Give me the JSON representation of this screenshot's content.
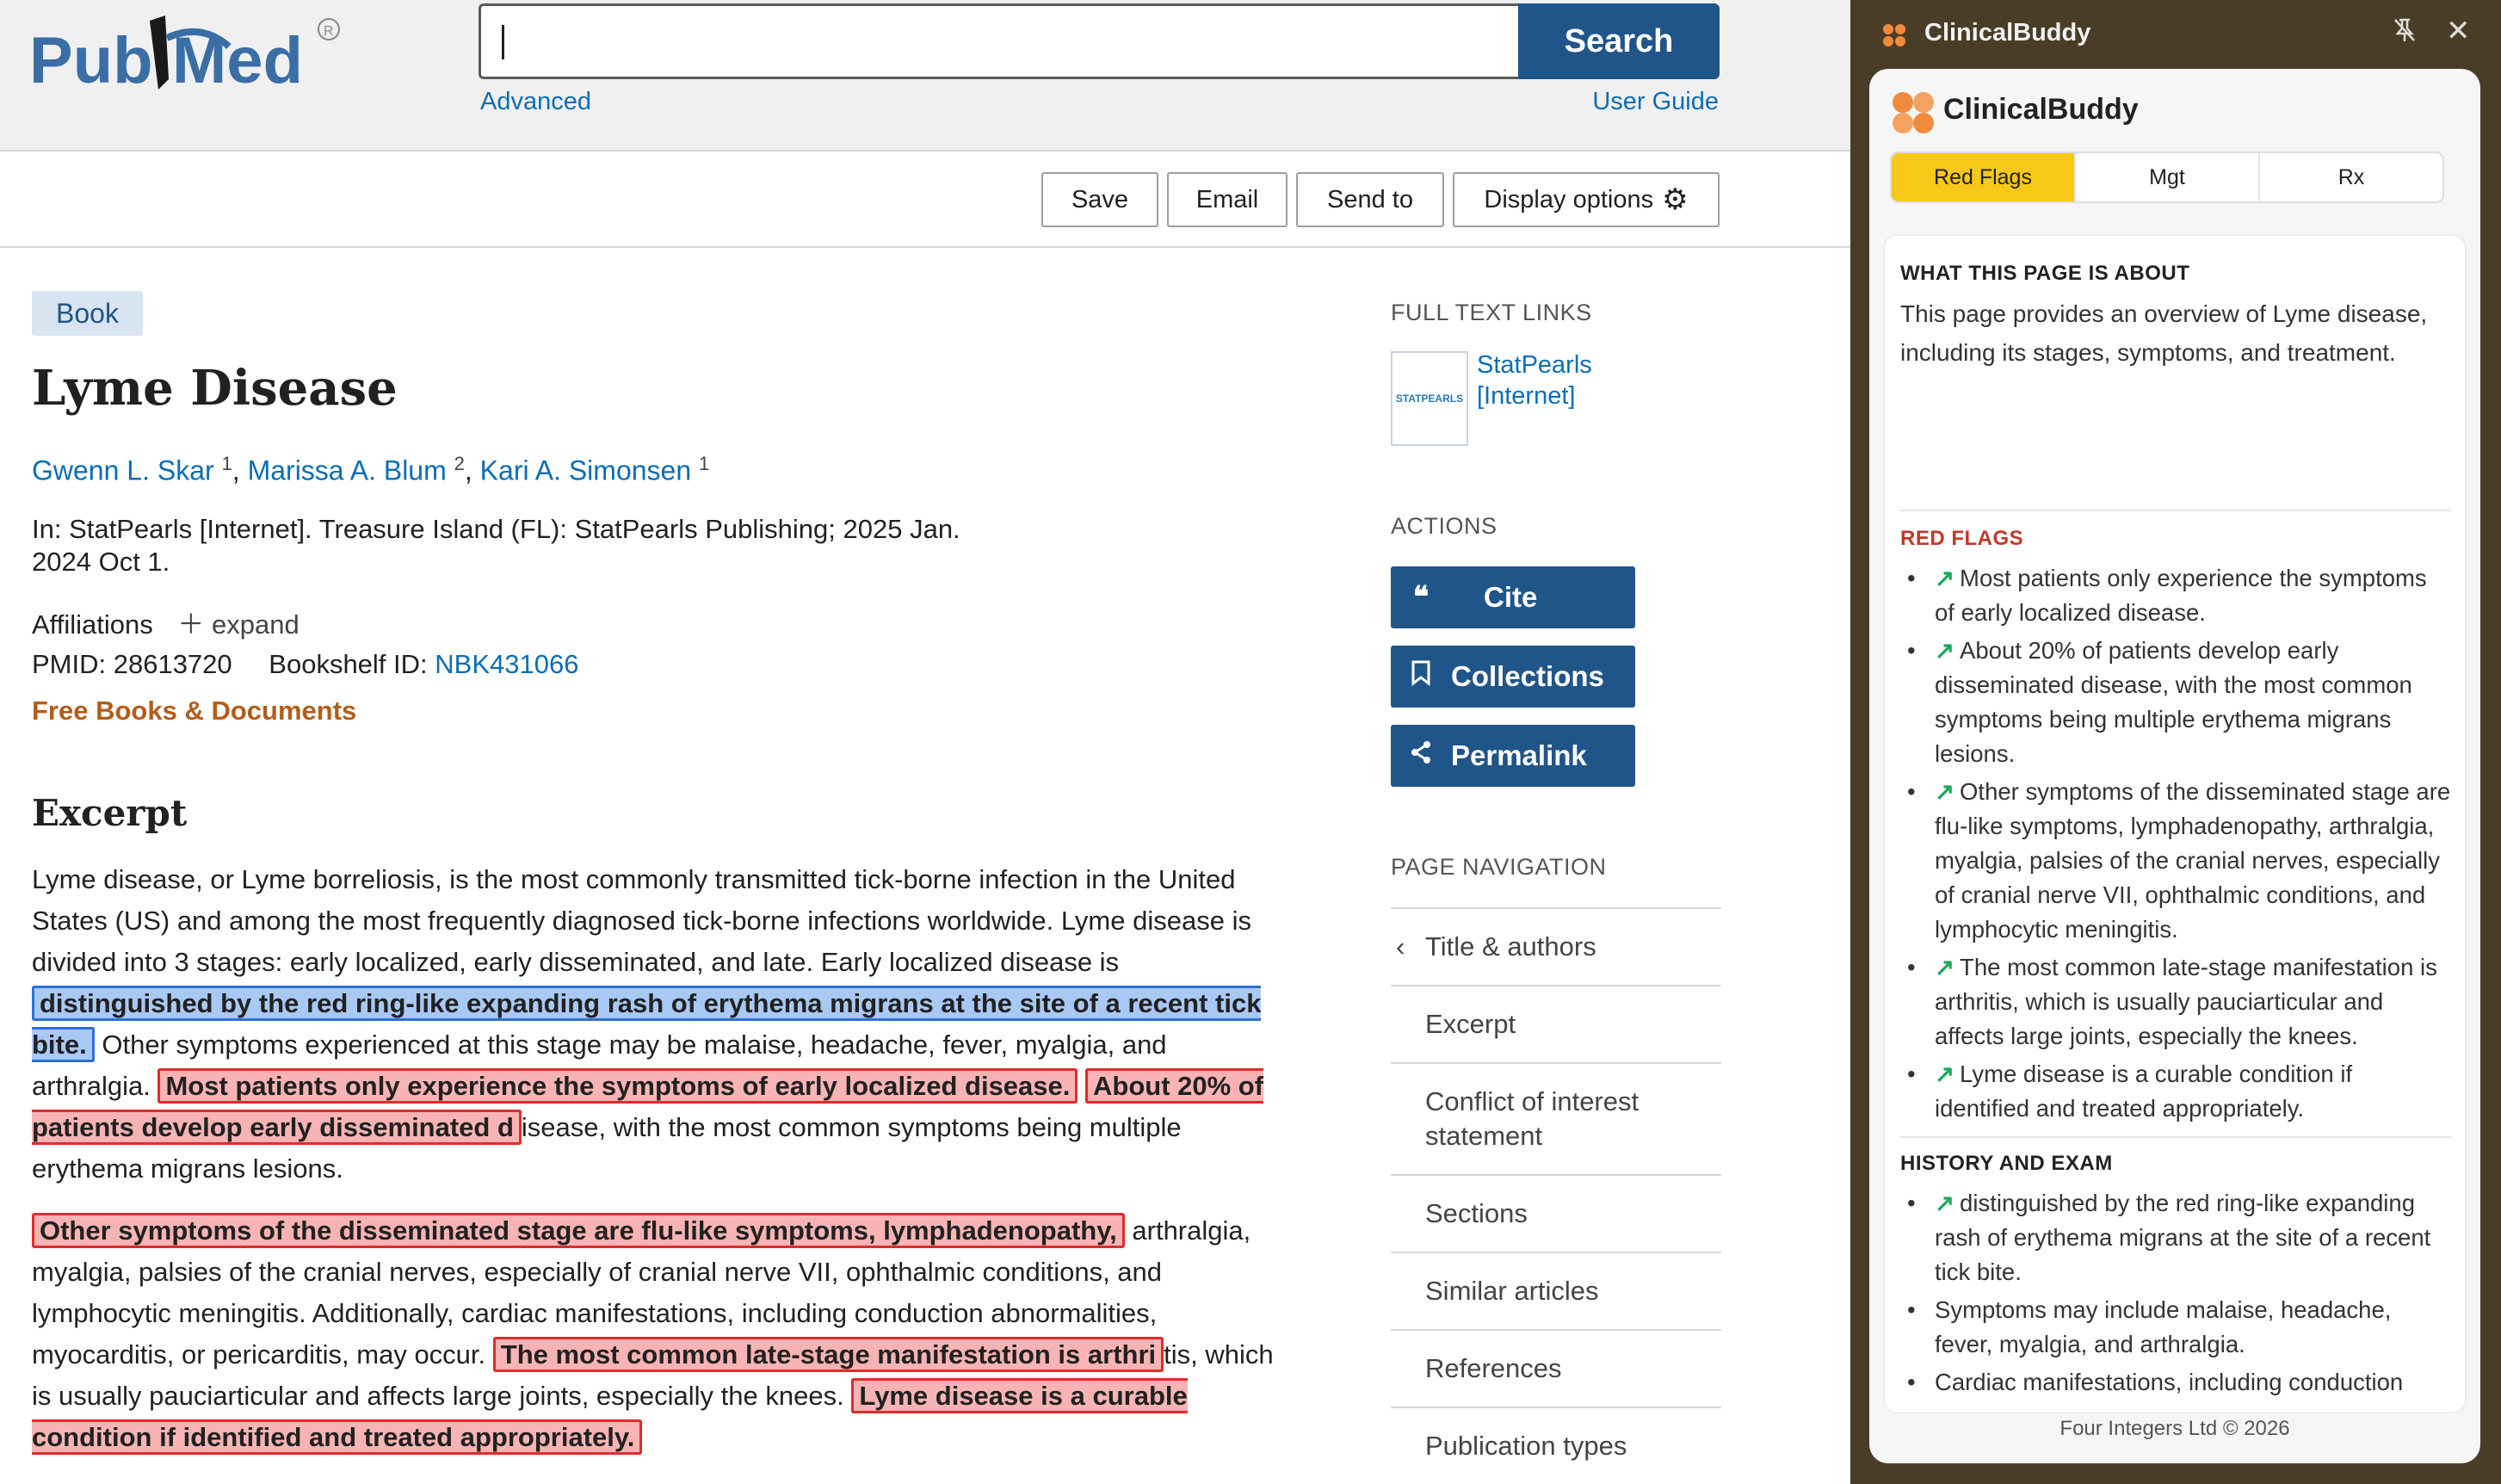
{
  "pubmed": {
    "logo_text": "PubMed",
    "search": {
      "value": "",
      "button_label": "Search"
    },
    "advanced_link": "Advanced",
    "user_guide_link": "User Guide",
    "toolbar": {
      "save": "Save",
      "email": "Email",
      "send_to": "Send to",
      "display_options": "Display options"
    },
    "article": {
      "type_badge": "Book",
      "title": "Lyme Disease",
      "authors": [
        {
          "name": "Gwenn L. Skar",
          "sup": "1"
        },
        {
          "name": "Marissa A. Blum",
          "sup": "2"
        },
        {
          "name": "Kari A. Simonsen",
          "sup": "1"
        }
      ],
      "citation": "In: StatPearls [Internet]. Treasure Island (FL): StatPearls Publishing; 2025 Jan.",
      "citation_date": "2024 Oct 1.",
      "affiliations_label": "Affiliations",
      "expand_label": "expand",
      "pmid_label": "PMID: 28613720",
      "bookshelf_label": "Bookshelf ID:",
      "bookshelf_id": "NBK431066",
      "free_books": "Free Books & Documents",
      "excerpt_heading": "Excerpt",
      "p1": {
        "t1": "Lyme disease, or Lyme borreliosis, is the most commonly transmitted tick-borne infection in the United States (US) and among the most frequently diagnosed tick-borne infections worldwide. Lyme disease is divided into 3 stages: early localized, early disseminated, and late. Early localized disease is ",
        "h1": "distinguished by the red ring-like expanding rash of erythema migrans at the site of a recent tick bite.",
        "t2": " Other symptoms experienced at this stage may be malaise, headache, fever, myalgia, and arthralgia. ",
        "h2": "Most patients only experience the symptoms of early localized disease.",
        "h3": "About 20% of patients develop early disseminated d",
        "t3": "isease, with the most common symptoms being multiple erythema migrans lesions."
      },
      "p2": {
        "h1": "Other symptoms of the disseminated stage are flu-like symptoms, lymphadenopathy,",
        "t1": " arthralgia, myalgia, palsies of the cranial nerves, especially of cranial nerve VII, ophthalmic conditions, and lymphocytic meningitis. Additionally, cardiac manifestations, including conduction abnormalities, myocarditis, or pericarditis, may occur. ",
        "h2": "The most common late-stage manifestation is arthri",
        "t2": "tis, which is usually pauciarticular and affects large joints, especially the knees. ",
        "h3": "Lyme disease is a curable condition if identified and treated appropriately."
      }
    },
    "sidebar": {
      "full_text_heading": "FULL TEXT LINKS",
      "full_text_logo": "STATPEARLS",
      "full_text_link": "StatPearls [Internet]",
      "actions_heading": "ACTIONS",
      "cite": "Cite",
      "collections": "Collections",
      "permalink": "Permalink",
      "nav_heading": "PAGE NAVIGATION",
      "nav_items": [
        "Title & authors",
        "Excerpt",
        "Conflict of interest statement",
        "Sections",
        "Similar articles",
        "References",
        "Publication types"
      ]
    }
  },
  "clinicalbuddy": {
    "window_title": "ClinicalBuddy",
    "app_name": "ClinicalBuddy",
    "tabs": [
      "Red Flags",
      "Mgt",
      "Rx"
    ],
    "active_tab": "Red Flags",
    "about_heading": "WHAT THIS PAGE IS ABOUT",
    "about_text": "This page provides an overview of Lyme disease, including its stages, symptoms, and treatment.",
    "red_flags_heading": "RED FLAGS",
    "red_flags": [
      "Most patients only experience the symptoms of early localized disease.",
      "About 20% of patients develop early disseminated disease, with the most common symptoms being multiple erythema migrans lesions.",
      "Other symptoms of the disseminated stage are flu-like symptoms, lymphadenopathy, arthralgia, myalgia, palsies of the cranial nerves, especially of cranial nerve VII, ophthalmic conditions, and lymphocytic meningitis.",
      "The most common late-stage manifestation is arthritis, which is usually pauciarticular and affects large joints, especially the knees.",
      "Lyme disease is a curable condition if identified and treated appropriately."
    ],
    "history_heading": "HISTORY AND EXAM",
    "history": [
      "distinguished by the red ring-like expanding rash of erythema migrans at the site of a recent tick bite.",
      "Symptoms may include malaise, headache, fever, myalgia, and arthralgia.",
      "Cardiac manifestations, including conduction"
    ],
    "footer": "Four Integers Ltd © 2026",
    "colors": {
      "accent": "#f7c817",
      "chrome": "#4a3d28",
      "red_heading": "#c0392b",
      "arrow": "#1da85a"
    }
  }
}
